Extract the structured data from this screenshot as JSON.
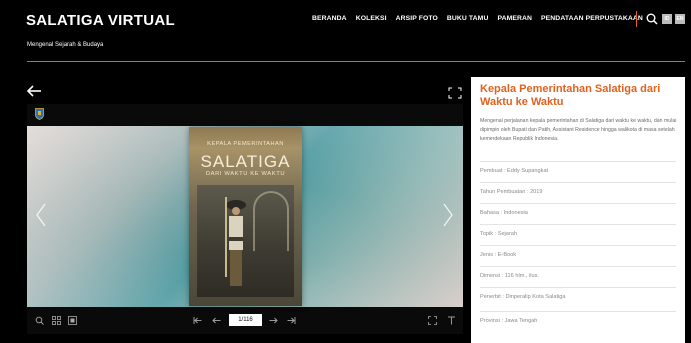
{
  "header": {
    "brand": "SALATIGA VIRTUAL",
    "nav": [
      "BERANDA",
      "KOLEKSI",
      "ARSIP FOTO",
      "BUKU TAMU",
      "PAMERAN",
      "PENDATAAN PERPUSTAKAAN"
    ],
    "lang": [
      "ID",
      "EN"
    ]
  },
  "subtitle": "Mengenal Sejarah & Budaya",
  "book": {
    "header": "KEPALA PEMERINTAHAN",
    "title": "SALATIGA",
    "subtitle": "DARI WAKTU KE WAKTU"
  },
  "viewer": {
    "page_indicator": "1/116"
  },
  "panel": {
    "title": "Kepala Pemerintahan Salatiga dari Waktu ke Waktu",
    "description": "Mengenal perjalanan kepala pemerintahan di Salatiga dari waktu ke waktu, dan mulai dipimpin oleh Bupati dan Patih, Assistant Residence hingga walikota di masa setelah kemerdekaan Republik Indonesia.",
    "meta": [
      "Pembuat : Eddy Supangkat",
      "Tahun Pembuatan : 2019",
      "Bahasa : Indonesia",
      "Topik : Sejarah",
      "Jenis : E-Book",
      "Dimensi : 116 hlm., ilus.",
      "Penerbit : Dinperalip Kota Salatiga",
      "Provinsi : Jawa Tengah"
    ]
  },
  "colors": {
    "accent": "#e0621f",
    "background": "#000000",
    "panel": "#ffffff"
  }
}
